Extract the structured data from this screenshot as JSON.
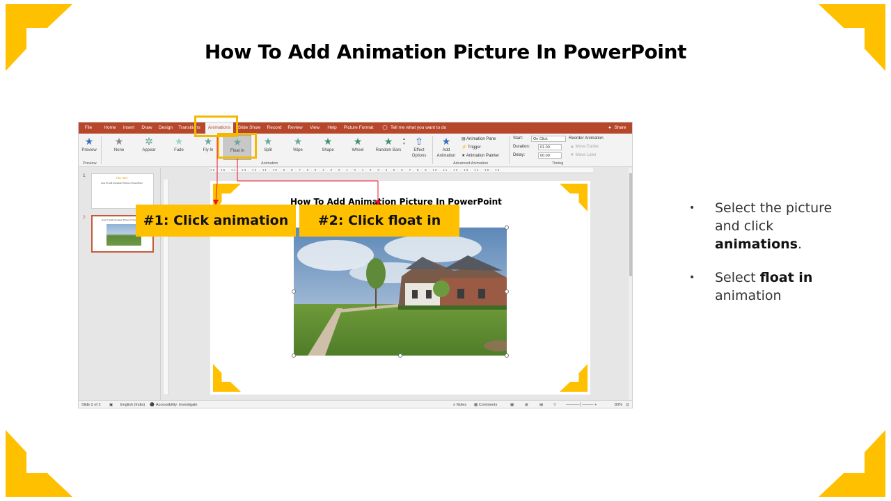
{
  "slide": {
    "title": "How To Add Animation Picture In PowerPoint",
    "accent_color": "#ffc000",
    "bullets": [
      {
        "pre": "Select the picture and click ",
        "bold": "animations",
        "post": "."
      },
      {
        "pre": "Select ",
        "bold": "float in",
        "post": " animation"
      }
    ],
    "callouts": [
      "#1: Click animation",
      "#2: Click float in"
    ]
  },
  "powerpoint": {
    "tabs": [
      "File",
      "Home",
      "Insert",
      "Draw",
      "Design",
      "Transitions",
      "Animations",
      "Slide Show",
      "Record",
      "Review",
      "View",
      "Help",
      "Picture Format"
    ],
    "active_tab": "Animations",
    "tell_me": "Tell me what you want to do",
    "share": "Share",
    "preview_label": "Preview",
    "preview_group": "Preview",
    "animations": [
      "None",
      "Appear",
      "Fade",
      "Fly In",
      "Float In",
      "Split",
      "Wipe",
      "Shape",
      "Wheel",
      "Random Bars"
    ],
    "selected_animation": "Float In",
    "effect_options": "Effect Options",
    "add_animation": "Add Animation",
    "animation_group": "Animation",
    "advanced_group": "Advanced Animation",
    "animation_pane": "Animation Pane",
    "trigger": "Trigger",
    "animation_painter": "Animation Painter",
    "timing_group": "Timing",
    "start_label": "Start:",
    "start_value": "On Click",
    "duration_label": "Duration:",
    "duration_value": "01.00",
    "delay_label": "Delay:",
    "delay_value": "00.00",
    "reorder_label": "Reorder Animation",
    "move_earlier": "Move Earlier",
    "move_later": "Move Later",
    "ruler_text": "16 · 15 · 14 · 13 · 12 · 11 · 10 · 9 · 8 · 7 · 6 · 5 · 4 · 3 · 2 · 1 · 0 · 1 · 2 · 3 · 4 · 5 · 6 · 7 · 8 · 9 · 10 · 11 · 12 · 13 · 14 · 15 · 16",
    "thumb_numbers": [
      "1",
      "2"
    ],
    "thumb1_title": "Title Here",
    "thumb1_sub": "How To Add Animation Picture In PowerPoint",
    "thumb2_title": "How To Add Animation Picture In PowerPoint",
    "inner_slide_title": "How To Add Animation Picture In PowerPoint",
    "status": {
      "slide_of": "Slide 2 of 2",
      "language": "English (India)",
      "accessibility": "Accessibility: Investigate",
      "notes": "Notes",
      "comments": "Comments",
      "zoom": "83%"
    }
  }
}
